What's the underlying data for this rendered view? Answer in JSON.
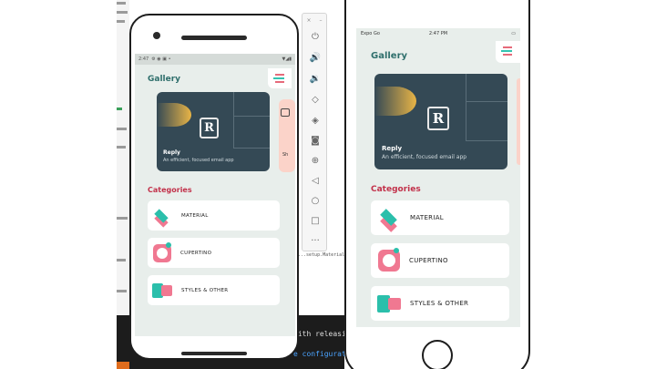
{
  "android": {
    "status_time": "2:47",
    "gallery_title": "Gallery",
    "card": {
      "caption": "Reply",
      "subtitle": "An efficient, focused email app",
      "logo": "R"
    },
    "peek_text": "Sh",
    "categories_title": "Categories",
    "categories": [
      {
        "label": "MATERIAL",
        "icon": "material-layers-icon"
      },
      {
        "label": "CUPERTINO",
        "icon": "cupertino-icon"
      },
      {
        "label": "STYLES & OTHER",
        "icon": "styles-icon"
      }
    ]
  },
  "iphone": {
    "carrier": "Expo Go",
    "status_time": "2:47 PM",
    "gallery_title": "Gallery",
    "card": {
      "caption": "Reply",
      "subtitle": "An efficient, focused email app",
      "logo": "R"
    },
    "categories_title": "Categories",
    "categories": [
      {
        "label": "MATERIAL",
        "icon": "material-layers-icon"
      },
      {
        "label": "CUPERTINO",
        "icon": "cupertino-icon"
      },
      {
        "label": "STYLES & OTHER",
        "icon": "styles-icon"
      }
    ]
  },
  "desktop": {
    "console_line1": "with releasing t",
    "console_line2": "e configuration",
    "small_text": "...setup.Material"
  },
  "colors": {
    "accent_teal": "#2f6f6c",
    "accent_red": "#c2314a",
    "card_bg": "#344955",
    "screen_bg": "#e8eeeb"
  }
}
